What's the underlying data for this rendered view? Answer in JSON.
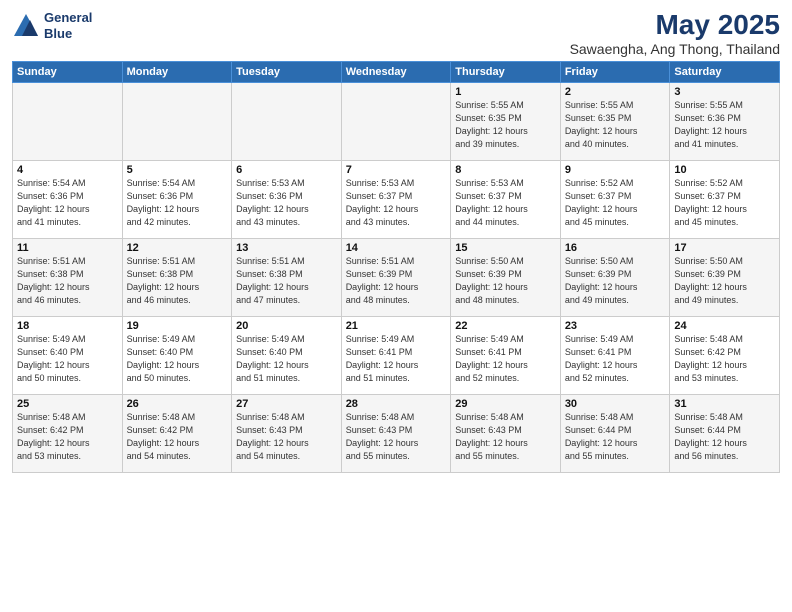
{
  "header": {
    "logo_line1": "General",
    "logo_line2": "Blue",
    "title": "May 2025",
    "subtitle": "Sawaengha, Ang Thong, Thailand"
  },
  "days_of_week": [
    "Sunday",
    "Monday",
    "Tuesday",
    "Wednesday",
    "Thursday",
    "Friday",
    "Saturday"
  ],
  "weeks": [
    [
      {
        "day": "",
        "info": ""
      },
      {
        "day": "",
        "info": ""
      },
      {
        "day": "",
        "info": ""
      },
      {
        "day": "",
        "info": ""
      },
      {
        "day": "1",
        "info": "Sunrise: 5:55 AM\nSunset: 6:35 PM\nDaylight: 12 hours\nand 39 minutes."
      },
      {
        "day": "2",
        "info": "Sunrise: 5:55 AM\nSunset: 6:35 PM\nDaylight: 12 hours\nand 40 minutes."
      },
      {
        "day": "3",
        "info": "Sunrise: 5:55 AM\nSunset: 6:36 PM\nDaylight: 12 hours\nand 41 minutes."
      }
    ],
    [
      {
        "day": "4",
        "info": "Sunrise: 5:54 AM\nSunset: 6:36 PM\nDaylight: 12 hours\nand 41 minutes."
      },
      {
        "day": "5",
        "info": "Sunrise: 5:54 AM\nSunset: 6:36 PM\nDaylight: 12 hours\nand 42 minutes."
      },
      {
        "day": "6",
        "info": "Sunrise: 5:53 AM\nSunset: 6:36 PM\nDaylight: 12 hours\nand 43 minutes."
      },
      {
        "day": "7",
        "info": "Sunrise: 5:53 AM\nSunset: 6:37 PM\nDaylight: 12 hours\nand 43 minutes."
      },
      {
        "day": "8",
        "info": "Sunrise: 5:53 AM\nSunset: 6:37 PM\nDaylight: 12 hours\nand 44 minutes."
      },
      {
        "day": "9",
        "info": "Sunrise: 5:52 AM\nSunset: 6:37 PM\nDaylight: 12 hours\nand 45 minutes."
      },
      {
        "day": "10",
        "info": "Sunrise: 5:52 AM\nSunset: 6:37 PM\nDaylight: 12 hours\nand 45 minutes."
      }
    ],
    [
      {
        "day": "11",
        "info": "Sunrise: 5:51 AM\nSunset: 6:38 PM\nDaylight: 12 hours\nand 46 minutes."
      },
      {
        "day": "12",
        "info": "Sunrise: 5:51 AM\nSunset: 6:38 PM\nDaylight: 12 hours\nand 46 minutes."
      },
      {
        "day": "13",
        "info": "Sunrise: 5:51 AM\nSunset: 6:38 PM\nDaylight: 12 hours\nand 47 minutes."
      },
      {
        "day": "14",
        "info": "Sunrise: 5:51 AM\nSunset: 6:39 PM\nDaylight: 12 hours\nand 48 minutes."
      },
      {
        "day": "15",
        "info": "Sunrise: 5:50 AM\nSunset: 6:39 PM\nDaylight: 12 hours\nand 48 minutes."
      },
      {
        "day": "16",
        "info": "Sunrise: 5:50 AM\nSunset: 6:39 PM\nDaylight: 12 hours\nand 49 minutes."
      },
      {
        "day": "17",
        "info": "Sunrise: 5:50 AM\nSunset: 6:39 PM\nDaylight: 12 hours\nand 49 minutes."
      }
    ],
    [
      {
        "day": "18",
        "info": "Sunrise: 5:49 AM\nSunset: 6:40 PM\nDaylight: 12 hours\nand 50 minutes."
      },
      {
        "day": "19",
        "info": "Sunrise: 5:49 AM\nSunset: 6:40 PM\nDaylight: 12 hours\nand 50 minutes."
      },
      {
        "day": "20",
        "info": "Sunrise: 5:49 AM\nSunset: 6:40 PM\nDaylight: 12 hours\nand 51 minutes."
      },
      {
        "day": "21",
        "info": "Sunrise: 5:49 AM\nSunset: 6:41 PM\nDaylight: 12 hours\nand 51 minutes."
      },
      {
        "day": "22",
        "info": "Sunrise: 5:49 AM\nSunset: 6:41 PM\nDaylight: 12 hours\nand 52 minutes."
      },
      {
        "day": "23",
        "info": "Sunrise: 5:49 AM\nSunset: 6:41 PM\nDaylight: 12 hours\nand 52 minutes."
      },
      {
        "day": "24",
        "info": "Sunrise: 5:48 AM\nSunset: 6:42 PM\nDaylight: 12 hours\nand 53 minutes."
      }
    ],
    [
      {
        "day": "25",
        "info": "Sunrise: 5:48 AM\nSunset: 6:42 PM\nDaylight: 12 hours\nand 53 minutes."
      },
      {
        "day": "26",
        "info": "Sunrise: 5:48 AM\nSunset: 6:42 PM\nDaylight: 12 hours\nand 54 minutes."
      },
      {
        "day": "27",
        "info": "Sunrise: 5:48 AM\nSunset: 6:43 PM\nDaylight: 12 hours\nand 54 minutes."
      },
      {
        "day": "28",
        "info": "Sunrise: 5:48 AM\nSunset: 6:43 PM\nDaylight: 12 hours\nand 55 minutes."
      },
      {
        "day": "29",
        "info": "Sunrise: 5:48 AM\nSunset: 6:43 PM\nDaylight: 12 hours\nand 55 minutes."
      },
      {
        "day": "30",
        "info": "Sunrise: 5:48 AM\nSunset: 6:44 PM\nDaylight: 12 hours\nand 55 minutes."
      },
      {
        "day": "31",
        "info": "Sunrise: 5:48 AM\nSunset: 6:44 PM\nDaylight: 12 hours\nand 56 minutes."
      }
    ]
  ]
}
